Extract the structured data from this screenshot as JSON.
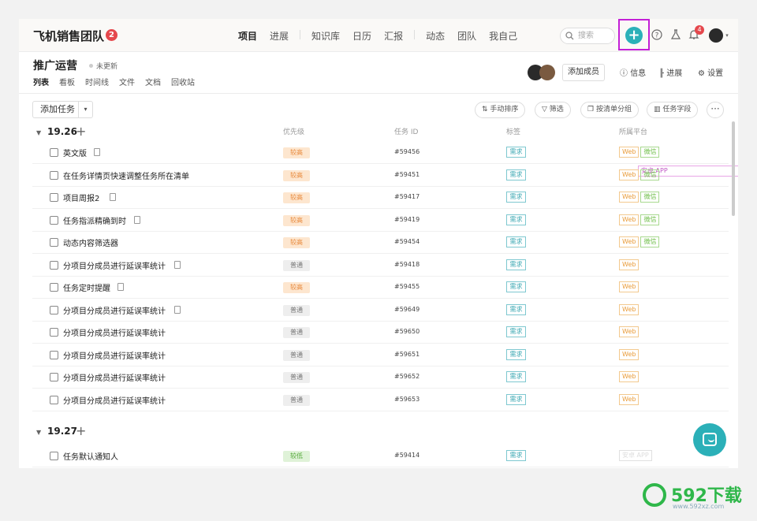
{
  "topbar": {
    "team_name": "飞机销售团队",
    "team_badge": "2",
    "nav": [
      "项目",
      "进展",
      "知识库",
      "日历",
      "汇报",
      "动态",
      "团队",
      "我自己"
    ],
    "search_placeholder": "搜索",
    "bell_badge": "4"
  },
  "project": {
    "title": "推广运营",
    "status": "未更新",
    "tabs": [
      "列表",
      "看板",
      "时间线",
      "文件",
      "文档",
      "回收站"
    ],
    "add_member": "添加成员",
    "info": "信息",
    "progress": "进展",
    "settings": "设置"
  },
  "toolbar": {
    "add_task": "添加任务",
    "sort": "手动排序",
    "filter": "筛选",
    "group": "按清单分组",
    "fields": "任务字段"
  },
  "columns": {
    "priority": "优先级",
    "task_id": "任务 ID",
    "tags": "标签",
    "platform": "所属平台"
  },
  "groups": [
    {
      "name": "19.26",
      "rows": [
        {
          "title": "英文版",
          "doc": true,
          "priority": "较高",
          "id": "#59456",
          "tag": "需求",
          "platforms": [
            "Web",
            "微信",
            "安卓 APP"
          ]
        },
        {
          "title": "在任务详情页快速调整任务所在清单",
          "doc": false,
          "priority": "较高",
          "id": "#59451",
          "tag": "需求",
          "platforms": [
            "Web",
            "微信"
          ]
        },
        {
          "title": "项目周报2",
          "doc": true,
          "priority": "较高",
          "id": "#59417",
          "tag": "需求",
          "platforms": [
            "Web",
            "微信"
          ]
        },
        {
          "title": "任务指派精确到时",
          "doc": true,
          "priority": "较高",
          "id": "#59419",
          "tag": "需求",
          "platforms": [
            "Web",
            "微信"
          ]
        },
        {
          "title": "动态内容筛选器",
          "doc": false,
          "priority": "较高",
          "id": "#59454",
          "tag": "需求",
          "platforms": [
            "Web",
            "微信"
          ]
        },
        {
          "title": "分项目分成员进行延误率统计",
          "doc": true,
          "priority": "普通",
          "id": "#59418",
          "tag": "需求",
          "platforms": [
            "Web"
          ]
        },
        {
          "title": "任务定时提醒",
          "doc": true,
          "priority": "较高",
          "id": "#59455",
          "tag": "需求",
          "platforms": [
            "Web"
          ]
        },
        {
          "title": "分项目分成员进行延误率统计",
          "doc": true,
          "priority": "普通",
          "id": "#59649",
          "tag": "需求",
          "platforms": [
            "Web"
          ]
        },
        {
          "title": "分项目分成员进行延误率统计",
          "doc": false,
          "priority": "普通",
          "id": "#59650",
          "tag": "需求",
          "platforms": [
            "Web"
          ]
        },
        {
          "title": "分项目分成员进行延误率统计",
          "doc": false,
          "priority": "普通",
          "id": "#59651",
          "tag": "需求",
          "platforms": [
            "Web"
          ]
        },
        {
          "title": "分项目分成员进行延误率统计",
          "doc": false,
          "priority": "普通",
          "id": "#59652",
          "tag": "需求",
          "platforms": [
            "Web"
          ]
        },
        {
          "title": "分项目分成员进行延误率统计",
          "doc": false,
          "priority": "普通",
          "id": "#59653",
          "tag": "需求",
          "platforms": [
            "Web"
          ]
        }
      ]
    },
    {
      "name": "19.27",
      "rows": [
        {
          "title": "任务默认通知人",
          "doc": false,
          "priority": "较低",
          "id": "#59414",
          "tag": "需求",
          "platforms": [
            "安卓 APP"
          ],
          "faint": true
        }
      ]
    }
  ],
  "priority_colors": {
    "较高": {
      "bg": "#fde6cf",
      "fg": "#e8883a"
    },
    "普通": {
      "bg": "#eeeeee",
      "fg": "#777777"
    },
    "较低": {
      "bg": "#dff2d8",
      "fg": "#55a83a"
    }
  },
  "watermark": {
    "text": "592下载",
    "sub": "www.592xz.com"
  }
}
